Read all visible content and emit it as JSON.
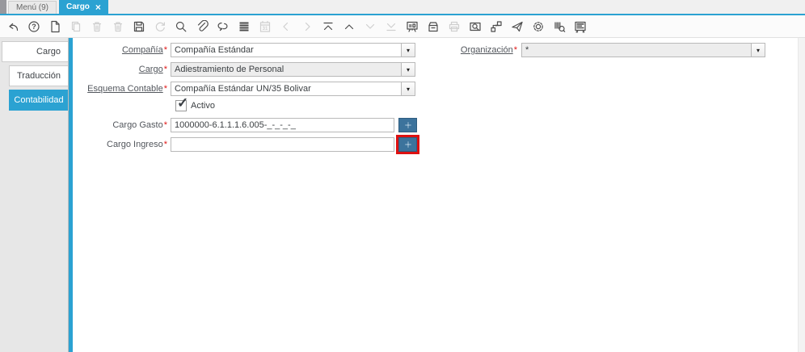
{
  "tabbar": {
    "menu_tab": "Menú (9)",
    "active_tab": "Cargo",
    "close_icon": "×"
  },
  "toolbar": {
    "icons": [
      {
        "name": "undo",
        "enabled": true
      },
      {
        "name": "help",
        "enabled": true
      },
      {
        "name": "new-record",
        "enabled": true
      },
      {
        "name": "copy-record",
        "enabled": false
      },
      {
        "name": "delete-record",
        "enabled": false
      },
      {
        "name": "delete-selection",
        "enabled": false
      },
      {
        "name": "save",
        "enabled": true
      },
      {
        "name": "refresh",
        "enabled": false
      },
      {
        "name": "find",
        "enabled": true
      },
      {
        "name": "attachment",
        "enabled": true
      },
      {
        "name": "chat",
        "enabled": true
      },
      {
        "name": "grid-toggle",
        "enabled": true
      },
      {
        "name": "calendar",
        "enabled": false
      },
      {
        "name": "parent-record",
        "enabled": false
      },
      {
        "name": "detail-record",
        "enabled": false
      },
      {
        "name": "first-record",
        "enabled": true
      },
      {
        "name": "previous-record",
        "enabled": true
      },
      {
        "name": "next-record",
        "enabled": false
      },
      {
        "name": "last-record",
        "enabled": false
      },
      {
        "name": "report",
        "enabled": true
      },
      {
        "name": "archive",
        "enabled": true
      },
      {
        "name": "print",
        "enabled": false
      },
      {
        "name": "zoom-across",
        "enabled": true
      },
      {
        "name": "workflow",
        "enabled": true
      },
      {
        "name": "send-mail",
        "enabled": true
      },
      {
        "name": "process",
        "enabled": true
      },
      {
        "name": "product-info",
        "enabled": true
      },
      {
        "name": "customize-window",
        "enabled": true
      }
    ]
  },
  "sidebar": {
    "tabs": [
      {
        "label": "Cargo",
        "selected": false
      },
      {
        "label": "Traducción",
        "selected": false
      },
      {
        "label": "Contabilidad",
        "selected": true
      }
    ]
  },
  "form": {
    "required_marker": "*",
    "compania": {
      "label": "Compañía",
      "value": "Compañía Estándar"
    },
    "organizacion": {
      "label": "Organización",
      "value": "*"
    },
    "cargo": {
      "label": "Cargo",
      "value": "Adiestramiento de Personal"
    },
    "esquema_contable": {
      "label": "Esquema Contable",
      "value": "Compañía Estándar UN/35 Bolivar"
    },
    "activo": {
      "label": "Activo",
      "checked": true,
      "check_icon": "✓"
    },
    "cargo_gasto": {
      "label": "Cargo Gasto",
      "value": "1000000-6.1.1.1.6.005-_-_-_-_"
    },
    "cargo_ingreso": {
      "label": "Cargo Ingreso",
      "value": ""
    }
  },
  "icons": {
    "caret": "▾"
  },
  "colors": {
    "accent": "#2BA2D2",
    "account_button": "#3C739C",
    "highlight_red": "#DD1111",
    "required_red": "#E01818"
  }
}
